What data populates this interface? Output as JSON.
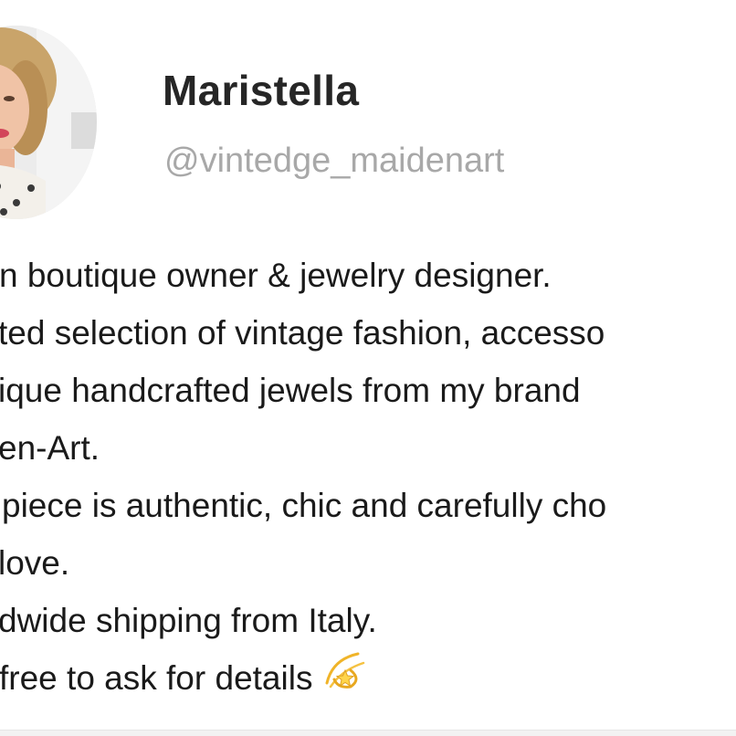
{
  "profile": {
    "display_name": "Maristella",
    "handle": "@vintedge_maidenart"
  },
  "bio": {
    "lines": [
      "n boutique owner & jewelry designer.",
      "ted selection of vintage fashion, accesso",
      "ique handcrafted jewels from my brand",
      "en-Art.",
      " piece is authentic, chic and carefully cho",
      "love.",
      "dwide shipping from Italy.",
      "free to ask for details"
    ],
    "trailing_emoji": "dizzy-star-icon"
  },
  "colors": {
    "name_text": "#262626",
    "handle_text": "#a8a8a8",
    "bio_text": "#1a1a1a",
    "background": "#ffffff",
    "emoji_gold": "#f5c242"
  }
}
